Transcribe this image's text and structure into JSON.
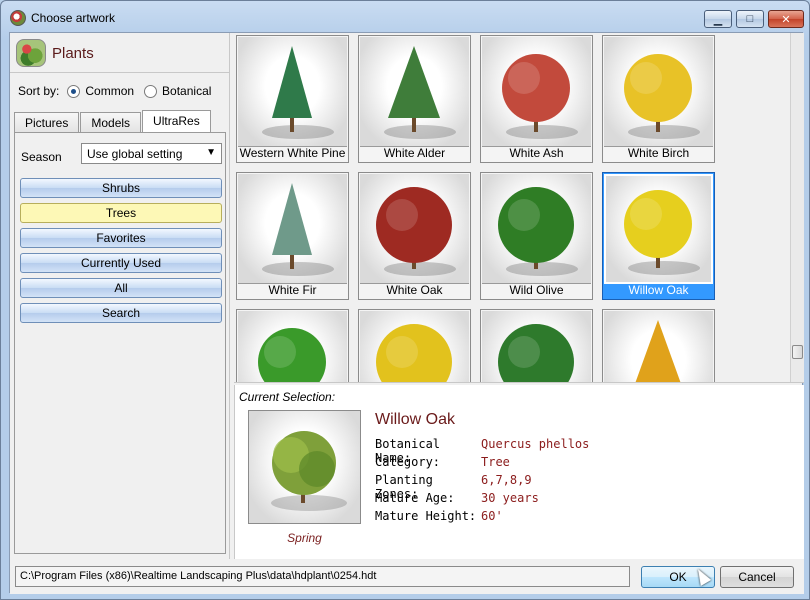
{
  "window": {
    "title": "Choose artwork",
    "controls": {
      "minimize": "▁",
      "maximize": "□",
      "close": "✕"
    }
  },
  "panel": {
    "title": "Plants",
    "sort_label": "Sort by:",
    "sort_options": [
      {
        "label": "Common",
        "selected": true
      },
      {
        "label": "Botanical",
        "selected": false
      }
    ],
    "tabs": [
      {
        "label": "Pictures",
        "active": false
      },
      {
        "label": "Models",
        "active": false
      },
      {
        "label": "UltraRes",
        "active": true
      }
    ],
    "season_label": "Season",
    "season_value": "Use global setting",
    "categories": [
      {
        "label": "Shrubs",
        "selected": false
      },
      {
        "label": "Trees",
        "selected": true
      },
      {
        "label": "Favorites",
        "selected": false
      },
      {
        "label": "Currently Used",
        "selected": false
      },
      {
        "label": "All",
        "selected": false
      },
      {
        "label": "Search",
        "selected": false
      }
    ]
  },
  "grid": {
    "items": [
      {
        "name": "Western White Pine",
        "color": "#2f7a4a",
        "shape": "conifer",
        "selected": false
      },
      {
        "name": "White Alder",
        "color": "#3f7d3a",
        "shape": "narrow",
        "selected": false
      },
      {
        "name": "White Ash",
        "color": "#c24a3c",
        "shape": "round",
        "selected": false
      },
      {
        "name": "White Birch",
        "color": "#e8c227",
        "shape": "round",
        "selected": false
      },
      {
        "name": "White Fir",
        "color": "#6f9a8a",
        "shape": "conifer",
        "selected": false
      },
      {
        "name": "White Oak",
        "color": "#9e2a22",
        "shape": "wide",
        "selected": false
      },
      {
        "name": "Wild Olive",
        "color": "#2f7d25",
        "shape": "wide",
        "selected": false
      },
      {
        "name": "Willow Oak",
        "color": "#e6cf1e",
        "shape": "round",
        "selected": true
      },
      {
        "name": "",
        "color": "#3a9a2a",
        "shape": "round",
        "selected": false
      },
      {
        "name": "",
        "color": "#e2c21d",
        "shape": "wide",
        "selected": false
      },
      {
        "name": "",
        "color": "#2e7a2c",
        "shape": "wide",
        "selected": false
      },
      {
        "name": "",
        "color": "#e0a21b",
        "shape": "narrow",
        "selected": false
      }
    ]
  },
  "selection": {
    "caption": "Current Selection:",
    "name": "Willow Oak",
    "season": "Spring",
    "thumb_color": "#7fa03a",
    "properties": [
      {
        "label": "Botanical Name:",
        "value": "Quercus phellos"
      },
      {
        "label": "Category:",
        "value": "Tree"
      },
      {
        "label": "Planting Zones:",
        "value": "6,7,8,9"
      },
      {
        "label": "Mature Age:",
        "value": "30 years"
      },
      {
        "label": "Mature Height:",
        "value": "60'"
      }
    ]
  },
  "footer": {
    "path": "C:\\Program Files (x86)\\Realtime Landscaping Plus\\data\\hdplant\\0254.hdt",
    "ok_label": "OK",
    "cancel_label": "Cancel"
  }
}
